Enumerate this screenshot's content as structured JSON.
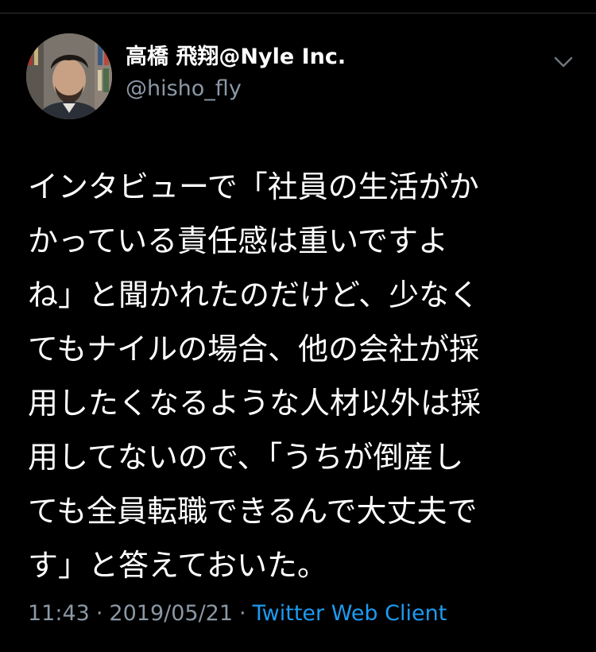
{
  "user": {
    "display_name": "高橋 飛翔@Nyle Inc.",
    "handle": "@hisho_fly",
    "avatar_icon": "user-photo-avatar"
  },
  "menu": {
    "icon": "chevron-down-icon"
  },
  "tweet": {
    "lines": [
      "インタビューで「社員の生活がか",
      "かっている責任感は重いですよ",
      "ね」と聞かれたのだけど、少なく",
      "てもナイルの場合、他の会社が採",
      "用したくなるような人材以外は採",
      "用してないので、「うちが倒産し",
      "ても全員転職できるんで大丈夫で",
      "す」と答えておいた。"
    ]
  },
  "meta": {
    "time": "11:43",
    "date": "2019/05/21",
    "separator": "·",
    "client": "Twitter Web Client"
  },
  "colors": {
    "background": "#000000",
    "text": "#ffffff",
    "secondary": "#8b98a5",
    "link": "#1d9bf0"
  }
}
